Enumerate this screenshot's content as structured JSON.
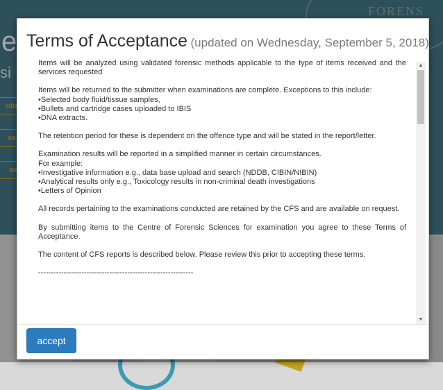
{
  "background": {
    "crest_text": "FORENS",
    "big_letter": "e",
    "side_text": "si",
    "side_buttons": [
      "ubr",
      "ssi",
      "se"
    ]
  },
  "modal": {
    "title": "Terms of Acceptance",
    "subtitle": "(updated on Wednesday, September 5, 2018)",
    "paragraphs": {
      "p1": "Items will be analyzed using validated forensic methods applicable to the type of items received and the services requested",
      "p2_intro": "Items will be returned to the submitter when examinations are complete. Exceptions to this include:",
      "p2_items": [
        "Selected body fluid/tissue samples,",
        "Bullets and cartridge cases uploaded to IBIS",
        "DNA extracts."
      ],
      "p3": "The retention period for these is dependent on the offence type and will be stated in the report/letter.",
      "p4_intro": "Examination results will be reported in a simplified manner in certain circumstances.",
      "p4_sub": "For example:",
      "p4_items": [
        "Investigative information e.g., data base upload and search (NDDB, CIBIN/NIBIN)",
        "Analytical results only e.g., Toxicology results in non-criminal death investigations",
        "Letters of Opinion"
      ],
      "p5": "All records pertaining to the examinations conducted are retained by the CFS and are available on request.",
      "p6": "By submitting items to the Centre of Forensic Sciences for examination you agree to these Terms of Acceptance.",
      "p7": "The content of CFS reports is described below. Please review this prior to accepting these terms.",
      "divider": "-------------------------------------------------------------"
    },
    "accept_label": "accept"
  },
  "icons": {
    "scroll_up": "triangle-up",
    "scroll_down": "triangle-down"
  }
}
